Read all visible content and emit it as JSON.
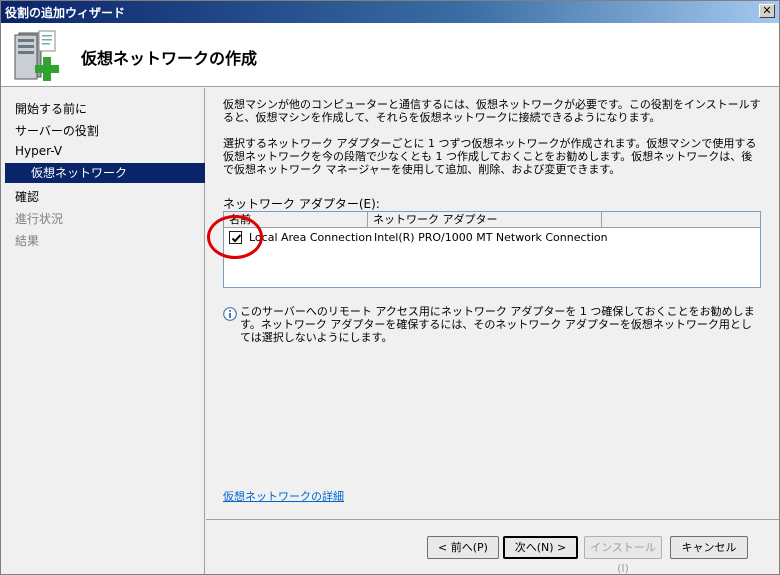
{
  "window": {
    "title": "役割の追加ウィザード",
    "close_glyph": "✕"
  },
  "header": {
    "title": "仮想ネットワークの作成",
    "icon": "server-add-icon"
  },
  "nav": {
    "items": [
      {
        "label": "開始する前に"
      },
      {
        "label": "サーバーの役割"
      },
      {
        "label": "Hyper-V"
      },
      {
        "label": "仮想ネットワーク"
      },
      {
        "label": "確認"
      },
      {
        "label": "進行状況"
      },
      {
        "label": "結果"
      }
    ]
  },
  "content": {
    "para1": "仮想マシンが他のコンピューターと通信するには、仮想ネットワークが必要です。この役割をインストールすると、仮想マシンを作成して、それらを仮想ネットワークに接続できるようになります。",
    "para2": "選択するネットワーク アダプターごとに 1 つずつ仮想ネットワークが作成されます。仮想マシンで使用する仮想ネットワークを今の段階で少なくとも 1 つ作成しておくことをお勧めします。仮想ネットワークは、後で仮想ネットワーク マネージャーを使用して追加、削除、および変更できます。",
    "adapters_label": "ネットワーク アダプター(E):",
    "table": {
      "columns": [
        "名前",
        "ネットワーク アダプター"
      ],
      "rows": [
        {
          "checked": true,
          "name": "Local Area Connection",
          "adapter": "Intel(R) PRO/1000 MT Network Connection"
        }
      ]
    },
    "info": "このサーバーへのリモート アクセス用にネットワーク アダプターを 1 つ確保しておくことをお勧めします。ネットワーク アダプターを確保するには、そのネットワーク アダプターを仮想ネットワーク用としては選択しないようにします。",
    "details_link": "仮想ネットワークの詳細"
  },
  "buttons": {
    "prev": "< 前へ(P)",
    "next": "次へ(N) >",
    "install": "インストール(I)",
    "cancel": "キャンセル"
  },
  "colors": {
    "selected_nav": "#0a246a",
    "link": "#0066cc",
    "annotation": "#e00000"
  }
}
